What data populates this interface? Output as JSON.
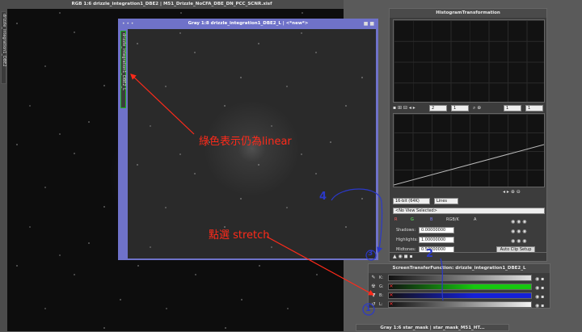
{
  "windows": {
    "rgb": {
      "title": "RGB 1:6 drizzle_integration1_DBE2 | M51_Drizzle_NoCFA_DBE_DN_PCC_SCNR.xisf",
      "side_tab": "drizzle_integration1_DBE2"
    },
    "gray": {
      "title": "Gray 1:8 drizzle_integration1_DBE2_L | <*new*>",
      "side_tab": "drizzle_integration1_DBE2_L"
    },
    "star_mask": {
      "title": "Gray 1:6 star_mask | star_mask_M51_HT..."
    }
  },
  "histogram": {
    "title": "HistogramTransformation",
    "zoom_h": "2",
    "zoom_v": "1",
    "zoom_h2": "1",
    "zoom_v2": "1",
    "bit_depth": "16-bit (64K)",
    "graph_style": "Lines",
    "view_selected": "<No View Selected>",
    "channels": [
      "R",
      "G",
      "B",
      "RGB/K",
      "A"
    ],
    "shadows_label": "Shadows:",
    "shadows_value": "0.00000000",
    "highlights_label": "Highlights:",
    "highlights_value": "1.00000000",
    "midtones_label": "Midtones:",
    "midtones_value": "0.50000000",
    "auto_clip_label": "Auto Clip Setup"
  },
  "stf": {
    "title": "ScreenTransferFunction: drizzle_integration1_DBE2_L",
    "channel_labels": [
      "K:",
      "G:",
      "B:",
      "L:"
    ],
    "bar_colors": [
      "#d9d9d9",
      "#16c80f",
      "#1520d8",
      "#f2f2f2"
    ]
  },
  "annotations": {
    "green_note": "綠色表示仍為linear",
    "stretch_note": "點選 stretch",
    "num1": "1",
    "num2": "2",
    "num3": "3",
    "num4": "4"
  },
  "colors": {
    "red_annotation": "#ff2a1a",
    "blue_annotation": "#2b39c8",
    "gray_frame": "#6f72c9"
  }
}
